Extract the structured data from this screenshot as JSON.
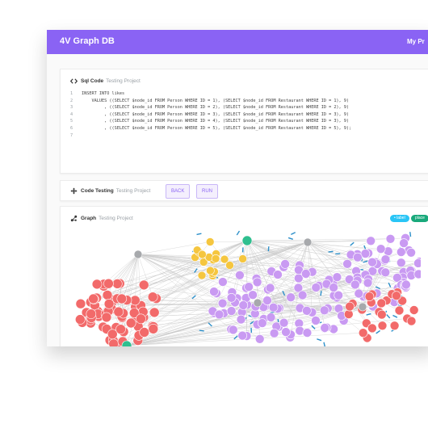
{
  "app": {
    "title": "4V Graph DB",
    "project_menu": "My Pr"
  },
  "sql_panel": {
    "title": "Sql Code",
    "project": "Testing Project",
    "lines": [
      {
        "n": "1",
        "text": "INSERT INTO likes"
      },
      {
        "n": "2",
        "text": "    VALUES ((SELECT $node_id FROM Person WHERE ID = 1), (SELECT $node_id FROM Restaurant WHERE ID = 1), 9)"
      },
      {
        "n": "3",
        "text": "         , ((SELECT $node_id FROM Person WHERE ID = 2), (SELECT $node_id FROM Restaurant WHERE ID = 2), 9)"
      },
      {
        "n": "4",
        "text": "         , ((SELECT $node_id FROM Person WHERE ID = 3), (SELECT $node_id FROM Restaurant WHERE ID = 3), 9)"
      },
      {
        "n": "5",
        "text": "         , ((SELECT $node_id FROM Person WHERE ID = 4), (SELECT $node_id FROM Restaurant WHERE ID = 3), 9)"
      },
      {
        "n": "6",
        "text": "         , ((SELECT $node_id FROM Person WHERE ID = 5), (SELECT $node_id FROM Restaurant WHERE ID = 5), 9);"
      },
      {
        "n": "7",
        "text": ""
      }
    ]
  },
  "testing_panel": {
    "title": "Code Testing",
    "project": "Testing Project",
    "back_label": "BACK",
    "run_label": "RUN"
  },
  "graph_panel": {
    "title": "Graph",
    "project": "Testing Project",
    "badges": [
      {
        "label": "• label",
        "color": "#29c5f6"
      },
      {
        "label": "place",
        "color": "#19a97b"
      }
    ],
    "node_colors": {
      "person": "#f26a6a",
      "restaurant": "#c99af2",
      "city": "#f5c63f",
      "hub": "#a7a9ac",
      "green": "#2fbf8f",
      "edge_accent": "#2c8fc9"
    }
  }
}
